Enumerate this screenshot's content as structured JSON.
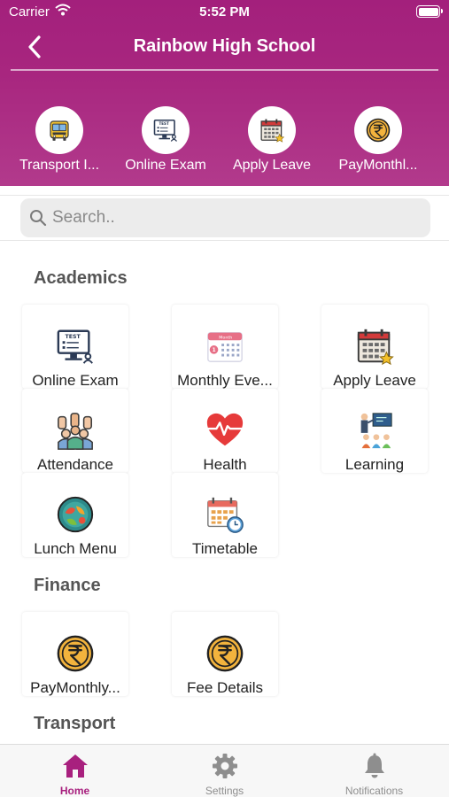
{
  "status_bar": {
    "carrier": "Carrier",
    "time": "5:52 PM"
  },
  "header": {
    "title": "Rainbow High School"
  },
  "quick_actions": [
    {
      "label": "Transport I...",
      "icon": "bus-icon"
    },
    {
      "label": "Online Exam",
      "icon": "test-monitor-icon"
    },
    {
      "label": "Apply Leave",
      "icon": "calendar-star-icon"
    },
    {
      "label": "PayMonthl...",
      "icon": "rupee-coin-icon"
    }
  ],
  "search": {
    "placeholder": "Search.."
  },
  "sections": {
    "academics": {
      "title": "Academics",
      "items": [
        {
          "label": "Online Exam",
          "icon": "test-monitor-icon"
        },
        {
          "label": "Monthly Eve...",
          "icon": "month-calendar-icon"
        },
        {
          "label": "Apply Leave",
          "icon": "calendar-star-icon"
        },
        {
          "label": "Attendance",
          "icon": "raised-hands-icon"
        },
        {
          "label": "Health",
          "icon": "heart-pulse-icon"
        },
        {
          "label": "Learning",
          "icon": "classroom-icon"
        },
        {
          "label": "Lunch Menu",
          "icon": "lunch-plate-icon"
        },
        {
          "label": "Timetable",
          "icon": "timetable-clock-icon"
        }
      ]
    },
    "finance": {
      "title": "Finance",
      "items": [
        {
          "label": "PayMonthly...",
          "icon": "rupee-coin-icon"
        },
        {
          "label": "Fee Details",
          "icon": "rupee-coin-icon"
        }
      ]
    },
    "transport": {
      "title": "Transport"
    }
  },
  "tabbar": {
    "active": "Home",
    "tabs": [
      {
        "label": "Home",
        "icon": "home-icon"
      },
      {
        "label": "Settings",
        "icon": "gear-icon"
      },
      {
        "label": "Notifications",
        "icon": "bell-icon"
      }
    ]
  },
  "colors": {
    "brand": "#a8207e",
    "header_bg": "#a8267f",
    "inactive_tab": "#8e8e8e"
  }
}
